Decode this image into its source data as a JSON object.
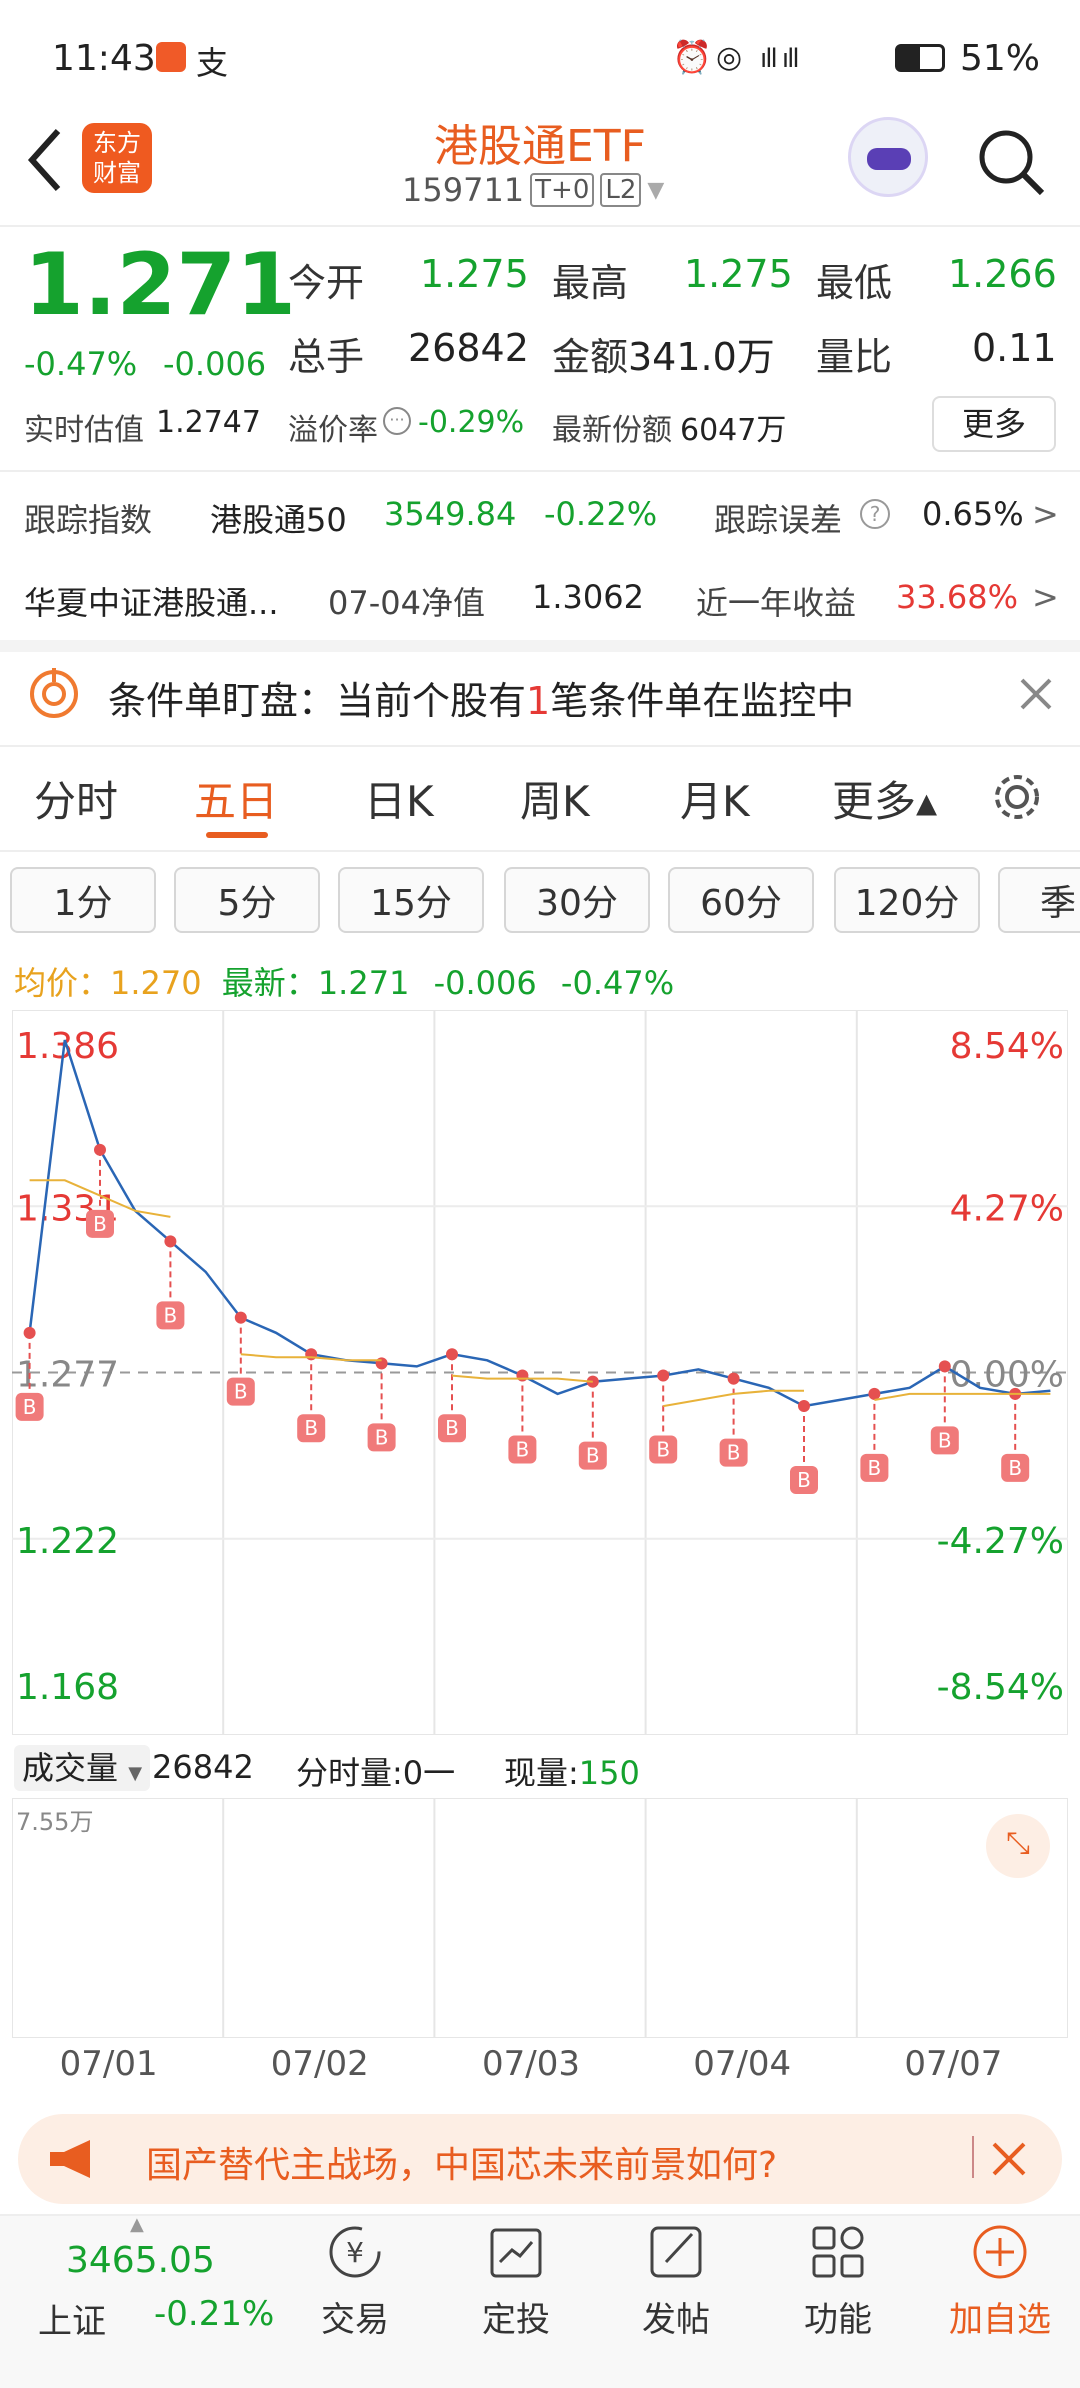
{
  "status": {
    "time": "11:43",
    "battery": "51%"
  },
  "header": {
    "title": "港股通ETF",
    "code": "159711",
    "tag1": "T+0",
    "tag2": "L2",
    "logo_line1": "东方",
    "logo_line2": "财富"
  },
  "quote": {
    "price": "1.271",
    "change_pct": "-0.47%",
    "change": "-0.006",
    "open_label": "今开",
    "open": "1.275",
    "high_label": "最高",
    "high": "1.275",
    "low_label": "最低",
    "low": "1.266",
    "vol_label": "总手",
    "vol": "26842",
    "amount_label": "金额",
    "amount": "341.0万",
    "ratio_label": "量比",
    "ratio": "0.11",
    "nav_est_label": "实时估值",
    "nav_est": "1.2747",
    "premium_label": "溢价率",
    "premium": "-0.29%",
    "shares_label": "最新份额",
    "shares": "6047万",
    "more": "更多"
  },
  "track": {
    "label": "跟踪指数",
    "index": "港股通50",
    "value": "3549.84",
    "pct": "-0.22%",
    "err_label": "跟踪误差",
    "err": "0.65%",
    "arrow": ">"
  },
  "fund": {
    "name": "华夏中证港股通...",
    "nav_label": "07-04净值",
    "nav": "1.3062",
    "yr_label": "近一年收益",
    "yr": "33.68%",
    "arrow": ">"
  },
  "alert": {
    "prefix": "条件单盯盘：当前个股有",
    "count": "1",
    "suffix": "笔条件单在监控中"
  },
  "tabs": [
    "分时",
    "五日",
    "日K",
    "周K",
    "月K",
    "更多▴"
  ],
  "periods": [
    "1分",
    "5分",
    "15分",
    "30分",
    "60分",
    "120分",
    "季"
  ],
  "legend": {
    "avg_label": "均价：",
    "avg": "1.270",
    "last_label": "最新：",
    "last": "1.271",
    "chg": "-0.006",
    "pct": "-0.47%"
  },
  "chart_data": {
    "type": "line",
    "x": [
      "07/01",
      "07/02",
      "07/03",
      "07/04",
      "07/07"
    ],
    "ylim": [
      1.168,
      1.386
    ],
    "y_labels_left": [
      "1.386",
      "1.331",
      "1.277",
      "1.222",
      "1.168"
    ],
    "y_labels_right": [
      "8.54%",
      "4.27%",
      "0.00%",
      "-4.27%",
      "-8.54%"
    ],
    "series": [
      {
        "name": "价格",
        "values": [
          1.29,
          1.386,
          1.35,
          1.33,
          1.32,
          1.31,
          1.295,
          1.29,
          1.283,
          1.281,
          1.28,
          1.279,
          1.283,
          1.281,
          1.276,
          1.27,
          1.274,
          1.275,
          1.276,
          1.278,
          1.275,
          1.272,
          1.266,
          1.268,
          1.27,
          1.272,
          1.279,
          1.272,
          1.27,
          1.271
        ]
      },
      {
        "name": "均价",
        "values": [
          1.34,
          1.34,
          1.335,
          1.33,
          1.328,
          null,
          1.283,
          1.282,
          1.282,
          1.281,
          1.281,
          null,
          1.276,
          1.275,
          1.275,
          1.275,
          1.274,
          null,
          1.266,
          1.268,
          1.27,
          1.271,
          1.271,
          null,
          1.268,
          1.27,
          1.27,
          1.27,
          1.27,
          1.27
        ]
      }
    ]
  },
  "volume": {
    "label": "成交量",
    "total": "26842",
    "tick_label": "分时量:",
    "tick": "0一",
    "now_label": "现量:",
    "now": "150",
    "max": "7.55万"
  },
  "banner": {
    "text": "国产替代主战场，中国芯未来前景如何?"
  },
  "bottom": {
    "index_value": "3465.05",
    "index_name": "上证",
    "index_pct": "-0.21%",
    "nav": [
      {
        "label": "交易",
        "icon": "trade-icon"
      },
      {
        "label": "定投",
        "icon": "invest-icon"
      },
      {
        "label": "发帖",
        "icon": "post-icon"
      },
      {
        "label": "功能",
        "icon": "grid-icon"
      },
      {
        "label": "加自选",
        "icon": "add-icon"
      }
    ]
  }
}
